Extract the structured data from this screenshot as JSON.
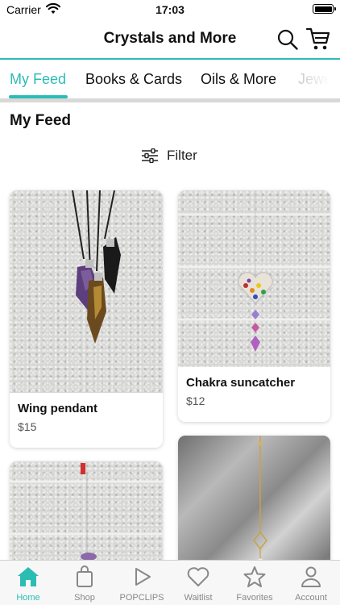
{
  "status_bar": {
    "carrier": "Carrier",
    "time": "17:03"
  },
  "nav": {
    "title": "Crystals and More",
    "search_icon": "search-icon",
    "cart_icon": "cart-icon"
  },
  "tabs": [
    {
      "label": "My Feed",
      "active": true
    },
    {
      "label": "Books & Cards",
      "active": false
    },
    {
      "label": "Oils & More",
      "active": false
    },
    {
      "label": "Jewe",
      "active": false
    }
  ],
  "section_title": "My Feed",
  "filter": {
    "label": "Filter",
    "icon": "sliders-icon"
  },
  "products": [
    {
      "name": "Wing pendant",
      "price": "$15"
    },
    {
      "name": "Chakra suncatcher",
      "price": "$12"
    },
    {
      "name": "",
      "price": ""
    },
    {
      "name": "",
      "price": ""
    }
  ],
  "bottom_tabs": [
    {
      "label": "Home",
      "icon": "home-icon",
      "active": true
    },
    {
      "label": "Shop",
      "icon": "shopping-bag-icon",
      "active": false
    },
    {
      "label": "POPCLIPS",
      "icon": "play-icon",
      "active": false
    },
    {
      "label": "Waitlist",
      "icon": "heart-icon",
      "active": false
    },
    {
      "label": "Favorites",
      "icon": "star-icon",
      "active": false
    },
    {
      "label": "Account",
      "icon": "person-icon",
      "active": false
    }
  ],
  "colors": {
    "accent": "#2bbcb4",
    "text": "#111111",
    "muted": "#888888"
  }
}
